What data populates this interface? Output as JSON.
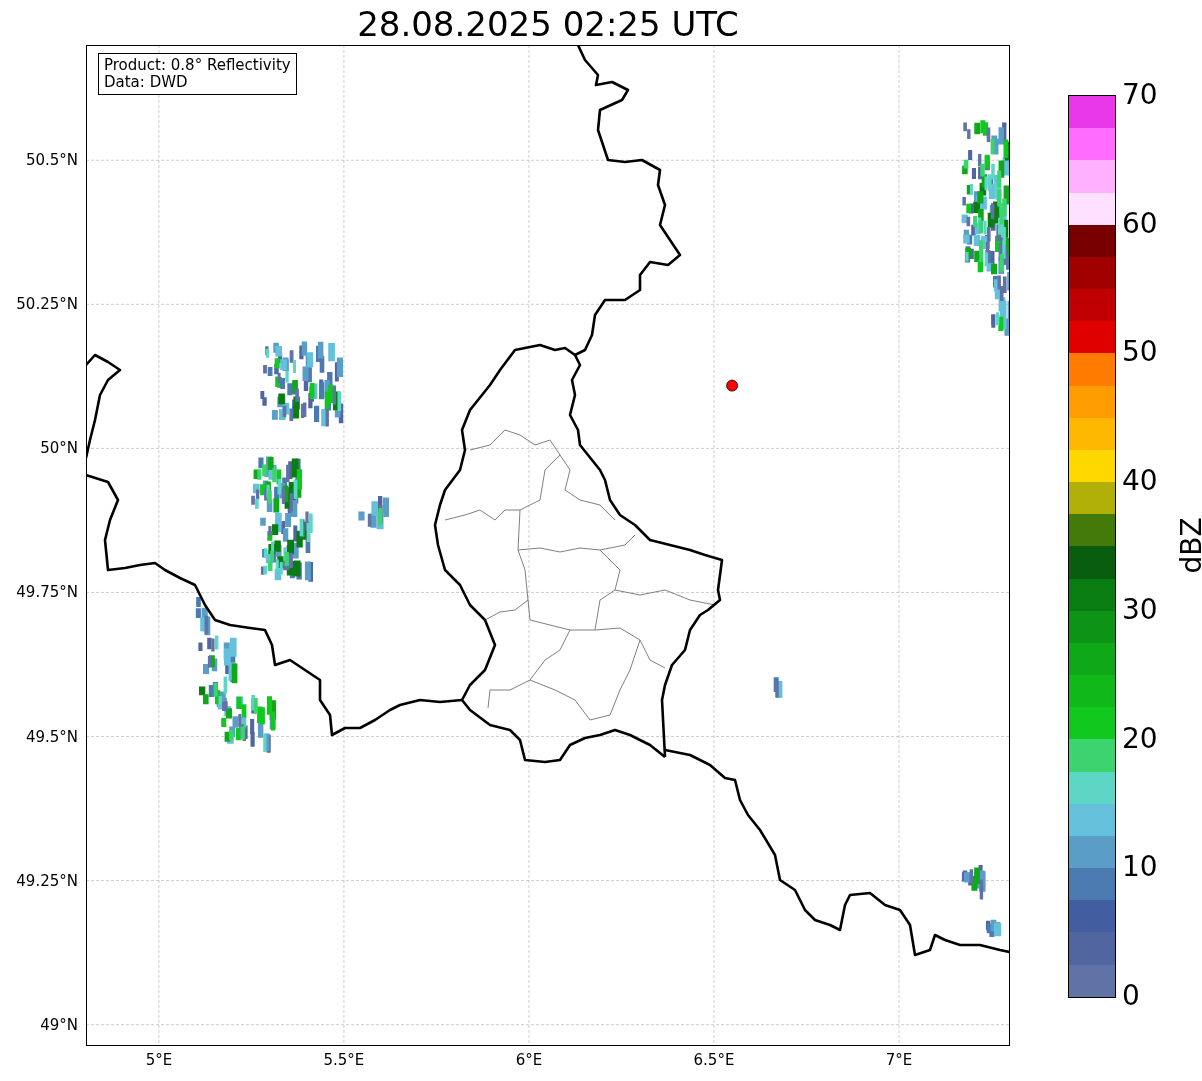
{
  "map": {
    "title": "28.08.2025 02:25 UTC",
    "y_labels": [
      "50.5°N",
      "50.25°N",
      "50°N",
      "49.75°N",
      "49.5°N",
      "49.25°N",
      "49°N"
    ],
    "x_labels": [
      "5°E",
      "5.5°E",
      "6°E",
      "6.5°E",
      "7°E"
    ],
    "info_box": [
      "Product: 0.8° Reflectivity",
      "Data: DWD"
    ]
  },
  "colorbar": {
    "label": "dBZ",
    "ticks": [
      "70",
      "60",
      "50",
      "40",
      "30",
      "20",
      "10",
      "0"
    ],
    "bins": [
      {
        "color": "#e838e8"
      },
      {
        "color": "#ff6cff"
      },
      {
        "color": "#ffb0ff"
      },
      {
        "color": "#ffe0ff"
      },
      {
        "color": "#780000"
      },
      {
        "color": "#a00000"
      },
      {
        "color": "#c00000"
      },
      {
        "color": "#e00000"
      },
      {
        "color": "#ff7c00"
      },
      {
        "color": "#ff9c00"
      },
      {
        "color": "#ffb800"
      },
      {
        "color": "#ffd800"
      },
      {
        "color": "#b0b008"
      },
      {
        "color": "#447a0a"
      },
      {
        "color": "#085e0e"
      },
      {
        "color": "#0a7d12"
      },
      {
        "color": "#0d9416"
      },
      {
        "color": "#0ea818"
      },
      {
        "color": "#10b81a"
      },
      {
        "color": "#10c81e"
      },
      {
        "color": "#3cd46e"
      },
      {
        "color": "#5ed6c6"
      },
      {
        "color": "#65c0dc"
      },
      {
        "color": "#5a9dc6"
      },
      {
        "color": "#4a7ab0"
      },
      {
        "color": "#425ea0"
      },
      {
        "color": "#5165a0"
      },
      {
        "color": "#6173a6"
      }
    ]
  }
}
